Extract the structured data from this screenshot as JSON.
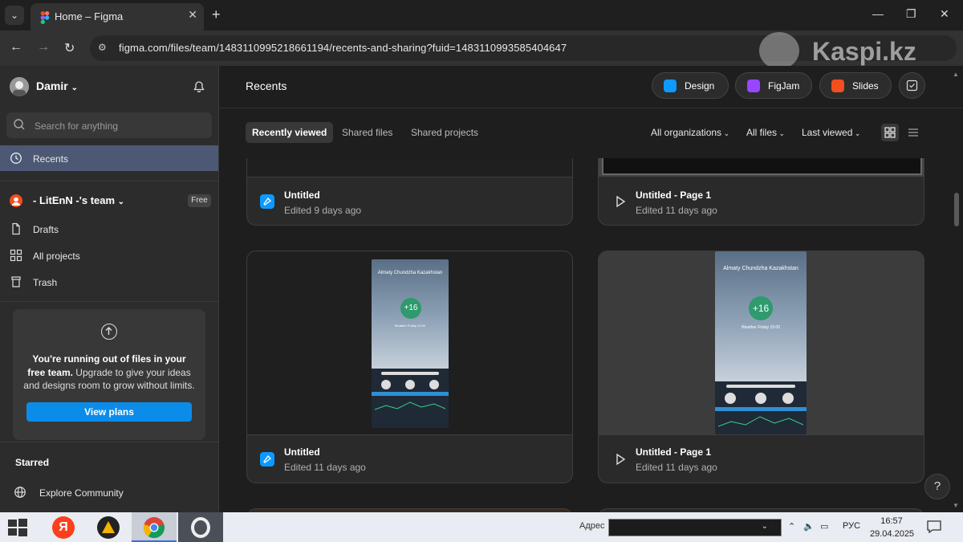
{
  "browser": {
    "tab_title": "Home – Figma",
    "url": "figma.com/files/team/1483110995218661194/recents-and-sharing?fuid=1483110993585404647",
    "watermark": "Kaspi.kz"
  },
  "sidebar": {
    "user_name": "Damir",
    "search_placeholder": "Search for anything",
    "recents_label": "Recents",
    "team_name": "- LitEnN -'s team",
    "team_badge": "Free",
    "items": [
      {
        "label": "Drafts",
        "icon": "file-icon"
      },
      {
        "label": "All projects",
        "icon": "grid-icon"
      },
      {
        "label": "Trash",
        "icon": "trash-icon"
      }
    ],
    "upsell": {
      "bold_text": "You're running out of files in your free team.",
      "text": " Upgrade to give your ideas and designs room to grow without limits.",
      "button": "View plans"
    },
    "starred_label": "Starred",
    "explore_label": "Explore Community"
  },
  "main": {
    "title": "Recents",
    "create_buttons": [
      {
        "label": "Design",
        "color": "#0d99ff"
      },
      {
        "label": "FigJam",
        "color": "#9747ff"
      },
      {
        "label": "Slides",
        "color": "#f24e1e"
      }
    ],
    "tabs": [
      "Recently viewed",
      "Shared files",
      "Shared projects"
    ],
    "filters": {
      "orgs": "All organizations",
      "files": "All files",
      "sort": "Last viewed"
    },
    "files": [
      {
        "title": "Untitled",
        "subtitle": "Edited 9 days ago",
        "icon": "design-file-icon"
      },
      {
        "title": "Untitled - Page 1",
        "subtitle": "Edited 11 days ago",
        "icon": "play-icon"
      },
      {
        "title": "Untitled",
        "subtitle": "Edited 11 days ago",
        "icon": "design-file-icon"
      },
      {
        "title": "Untitled - Page 1",
        "subtitle": "Edited 11 days ago",
        "icon": "play-icon"
      }
    ],
    "phone": {
      "city": "Almaty Chundzha Kazakhstan",
      "temp": "+16",
      "day": "Weather Friday 15:00"
    },
    "help": "?"
  },
  "taskbar": {
    "address_label": "Адрес",
    "lang": "РУС",
    "time": "16:57",
    "date": "29.04.2025"
  }
}
